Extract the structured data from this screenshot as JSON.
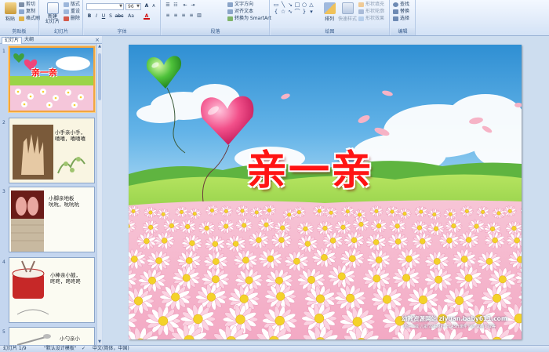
{
  "ribbon": {
    "clipboard": {
      "label": "剪贴板",
      "paste": "粘贴",
      "cut": "剪切",
      "copy": "复制",
      "format_painter": "格式刷"
    },
    "slides": {
      "label": "幻灯片",
      "new_slide": "新建\n幻灯片",
      "layout": "版式",
      "reset": "重设",
      "delete": "删除"
    },
    "font": {
      "label": "字体",
      "font_name": "",
      "font_size": "96",
      "buttons": [
        "B",
        "I",
        "U",
        "S",
        "abc",
        "A",
        "Aa",
        "A"
      ]
    },
    "paragraph": {
      "label": "段落",
      "text_direction": "文字方向",
      "align_text": "对齐文本",
      "convert_smartart": "转换为 SmartArt"
    },
    "drawing": {
      "label": "绘图",
      "arrange": "排列",
      "quick_styles": "快速样式",
      "shape_fill": "形状填充",
      "shape_outline": "形状轮廓",
      "shape_effects": "形状效果"
    },
    "editing": {
      "label": "编辑",
      "find": "查找",
      "replace": "替换",
      "select": "选择"
    }
  },
  "left_panel": {
    "tabs": [
      "幻灯片",
      "大纲"
    ],
    "close": "×",
    "slides": [
      {
        "num": "1",
        "title": "亲一亲"
      },
      {
        "num": "2",
        "text": "小手亲小手，\n嘻嘻，嘻嘻嘻"
      },
      {
        "num": "3",
        "text": "小脚亲地板\n吭吭，吭吭吭"
      },
      {
        "num": "4",
        "text": "小棒亲小鼓，\n咚咚，咚咚咚"
      },
      {
        "num": "5",
        "text": "小勺亲小"
      }
    ]
  },
  "slide": {
    "title": "亲一亲",
    "watermark": "幼教资源网站 ziyuan.baby611.com",
    "watermark_sub": "课件下载  儿歌  故事MP3  FLASH课件下载  试卷下载等"
  },
  "status_bar": {
    "slide_counter": "幻灯片 1/9",
    "theme": "\"默认设计模板\"",
    "language": "中文(简体，中国)"
  },
  "colors": {
    "title_red": "#ff1414",
    "selection_orange": "#f2a640",
    "ribbon_blue": "#15428b"
  }
}
